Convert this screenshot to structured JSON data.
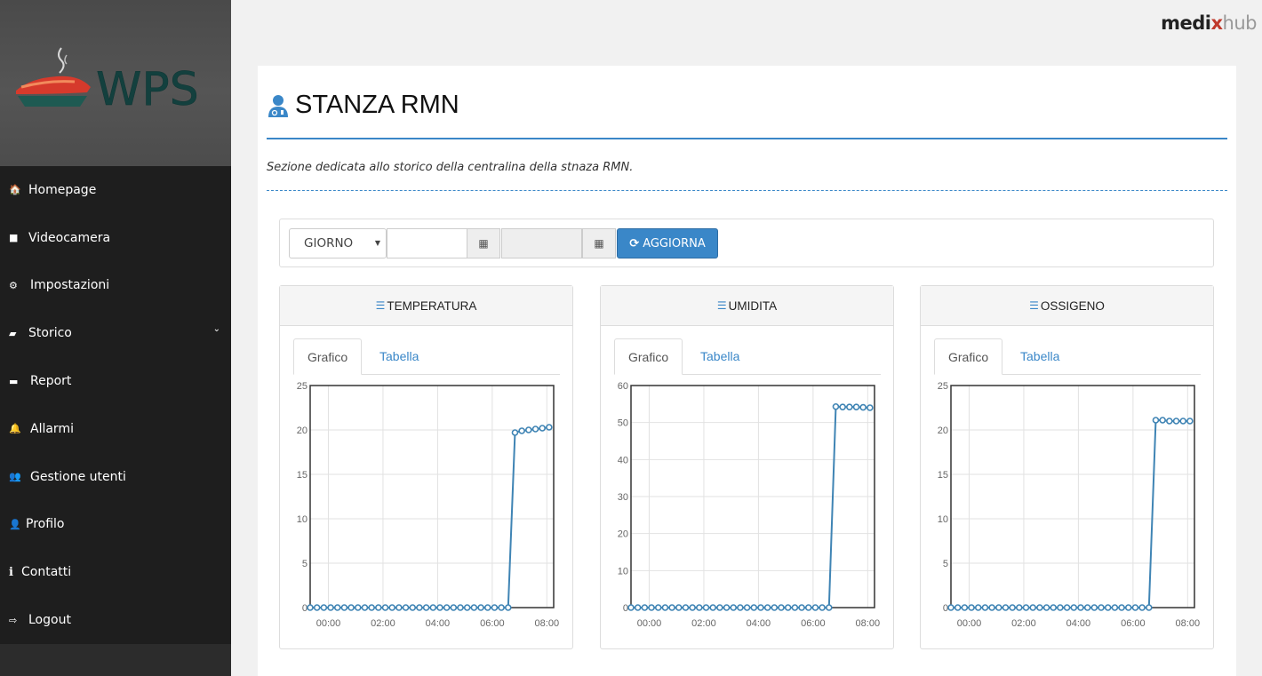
{
  "brand": {
    "part1": "medi",
    "part2": "x",
    "part3": "hub"
  },
  "logo": {
    "text": "WPS"
  },
  "sidebar": {
    "items": [
      {
        "label": "Homepage",
        "icon": "home-icon",
        "glyph": "🏠"
      },
      {
        "label": "Videocamera",
        "icon": "video-icon",
        "glyph": "■"
      },
      {
        "label": "Impostazioni",
        "icon": "gears-icon",
        "glyph": "⚙"
      },
      {
        "label": "Storico",
        "icon": "book-icon",
        "glyph": "▰"
      },
      {
        "label": "Report",
        "icon": "archive-icon",
        "glyph": "▬"
      },
      {
        "label": "Allarmi",
        "icon": "bell-icon",
        "glyph": "♦"
      },
      {
        "label": "Gestione utenti",
        "icon": "users-icon",
        "glyph": "●"
      },
      {
        "label": "Profilo",
        "icon": "user-icon",
        "glyph": "●"
      },
      {
        "label": "Contatti",
        "icon": "info-icon",
        "glyph": "i"
      },
      {
        "label": "Logout",
        "icon": "sign-out-icon",
        "glyph": "⇨"
      }
    ]
  },
  "page": {
    "title": "STANZA RMN",
    "description": "Sezione dedicata allo storico della centralina della stnaza RMN."
  },
  "filter": {
    "period_selected": "GIORNO",
    "date_from": "",
    "date_to": "",
    "refresh_label": "AGGIORNA"
  },
  "tabs": {
    "chart": "Grafico",
    "table": "Tabella"
  },
  "colors": {
    "accent": "#3a87c8",
    "line": "#3f84b4",
    "sidebar": "#1e1e1e"
  },
  "chart_data": [
    {
      "type": "line",
      "title": "TEMPERATURA",
      "x_ticks": [
        "00:00",
        "02:00",
        "04:00",
        "06:00",
        "08:00"
      ],
      "y_ticks": [
        0,
        5,
        10,
        15,
        20,
        25
      ],
      "ylim": [
        0,
        25
      ],
      "xlim": [
        -40,
        495
      ],
      "series": [
        {
          "x_minutes": [
            -40,
            -25,
            -10,
            5,
            20,
            35,
            50,
            65,
            80,
            95,
            110,
            125,
            140,
            155,
            170,
            185,
            200,
            215,
            230,
            245,
            260,
            275,
            290,
            305,
            320,
            335,
            350,
            365,
            380,
            395,
            410,
            425,
            440,
            455,
            470,
            485
          ],
          "values": [
            0,
            0,
            0,
            0,
            0,
            0,
            0,
            0,
            0,
            0,
            0,
            0,
            0,
            0,
            0,
            0,
            0,
            0,
            0,
            0,
            0,
            0,
            0,
            0,
            0,
            0,
            0,
            0,
            0,
            0,
            19.7,
            19.9,
            20.0,
            20.1,
            20.2,
            20.3
          ]
        }
      ]
    },
    {
      "type": "line",
      "title": "UMIDITA",
      "x_ticks": [
        "00:00",
        "02:00",
        "04:00",
        "06:00",
        "08:00"
      ],
      "y_ticks": [
        0,
        10,
        20,
        30,
        40,
        50,
        60
      ],
      "ylim": [
        0,
        60
      ],
      "xlim": [
        -40,
        495
      ],
      "series": [
        {
          "x_minutes": [
            -40,
            -25,
            -10,
            5,
            20,
            35,
            50,
            65,
            80,
            95,
            110,
            125,
            140,
            155,
            170,
            185,
            200,
            215,
            230,
            245,
            260,
            275,
            290,
            305,
            320,
            335,
            350,
            365,
            380,
            395,
            410,
            425,
            440,
            455,
            470,
            485
          ],
          "values": [
            0,
            0,
            0,
            0,
            0,
            0,
            0,
            0,
            0,
            0,
            0,
            0,
            0,
            0,
            0,
            0,
            0,
            0,
            0,
            0,
            0,
            0,
            0,
            0,
            0,
            0,
            0,
            0,
            0,
            0,
            54.3,
            54.2,
            54.2,
            54.2,
            54.1,
            54.0
          ]
        }
      ]
    },
    {
      "type": "line",
      "title": "OSSIGENO",
      "x_ticks": [
        "00:00",
        "02:00",
        "04:00",
        "06:00",
        "08:00"
      ],
      "y_ticks": [
        0,
        5,
        10,
        15,
        20,
        25
      ],
      "ylim": [
        0,
        25
      ],
      "xlim": [
        -40,
        495
      ],
      "series": [
        {
          "x_minutes": [
            -40,
            -25,
            -10,
            5,
            20,
            35,
            50,
            65,
            80,
            95,
            110,
            125,
            140,
            155,
            170,
            185,
            200,
            215,
            230,
            245,
            260,
            275,
            290,
            305,
            320,
            335,
            350,
            365,
            380,
            395,
            410,
            425,
            440,
            455,
            470,
            485
          ],
          "values": [
            0,
            0,
            0,
            0,
            0,
            0,
            0,
            0,
            0,
            0,
            0,
            0,
            0,
            0,
            0,
            0,
            0,
            0,
            0,
            0,
            0,
            0,
            0,
            0,
            0,
            0,
            0,
            0,
            0,
            0,
            21.1,
            21.1,
            21.0,
            21.0,
            21.0,
            21.0
          ]
        }
      ]
    }
  ]
}
